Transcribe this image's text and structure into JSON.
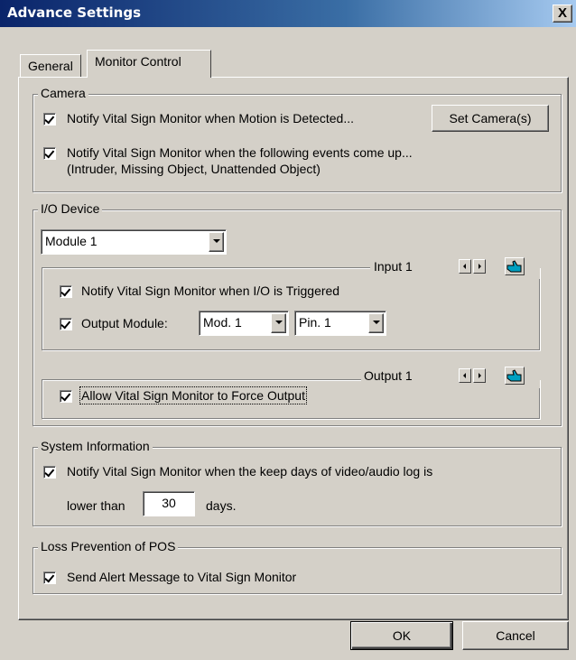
{
  "window": {
    "title": "Advance Settings",
    "close_symbol": "X"
  },
  "tabs": [
    {
      "label": "General"
    },
    {
      "label": "Monitor Control"
    }
  ],
  "camera": {
    "group_label": "Camera",
    "motion_label": "Notify Vital Sign Monitor when Motion is Detected...",
    "motion_checked": true,
    "set_camera_label": "Set Camera(s)",
    "events_label_line1": "Notify Vital Sign Monitor when the following events come up...",
    "events_label_line2": "(Intruder, Missing Object, Unattended Object)",
    "events_checked": true
  },
  "io_device": {
    "group_label": "I/O Device",
    "module_select": "Module 1",
    "input": {
      "label": "Input 1",
      "notify_label": "Notify Vital Sign Monitor when I/O is Triggered",
      "notify_checked": true,
      "output_module_label": "Output Module:",
      "output_module_checked": true,
      "mod_select": "Mod. 1",
      "pin_select": "Pin. 1"
    },
    "output": {
      "label": "Output 1",
      "force_label": "Allow Vital Sign Monitor to Force Output",
      "force_checked": true
    }
  },
  "system_info": {
    "group_label": "System Information",
    "notify_label": "Notify Vital Sign Monitor when the keep days of video/audio log is",
    "notify_checked": true,
    "lower_than_label": "lower than",
    "days_value": "30",
    "days_label": "days."
  },
  "loss_prevention": {
    "group_label": "Loss Prevention of POS",
    "alert_label": "Send Alert Message to Vital Sign Monitor",
    "alert_checked": true
  },
  "buttons": {
    "ok": "OK",
    "cancel": "Cancel"
  },
  "colors": {
    "titlebar_start": "#0a246a",
    "titlebar_end": "#a6caf0",
    "face": "#d4d0c8"
  },
  "icons": {
    "close": "close-icon",
    "checkbox": "check-icon",
    "dropdown": "chevron-down-icon",
    "prev": "arrow-left-icon",
    "next": "arrow-right-icon",
    "hand": "pointing-hand-icon"
  }
}
